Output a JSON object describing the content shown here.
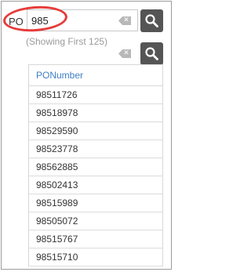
{
  "search": {
    "label": "PO",
    "value": "985",
    "showing_text": "(Showing First 125)"
  },
  "icons": {
    "search": "search-icon",
    "clear": "clear-icon"
  },
  "results": {
    "header": "PONumber",
    "rows": [
      "98511726",
      "98518978",
      "98529590",
      "98523778",
      "98562885",
      "98502413",
      "98515989",
      "98505072",
      "98515767",
      "98515710"
    ]
  },
  "colors": {
    "highlight": "#e63b3b",
    "header_text": "#3f7fc4",
    "search_button": "#555555"
  }
}
